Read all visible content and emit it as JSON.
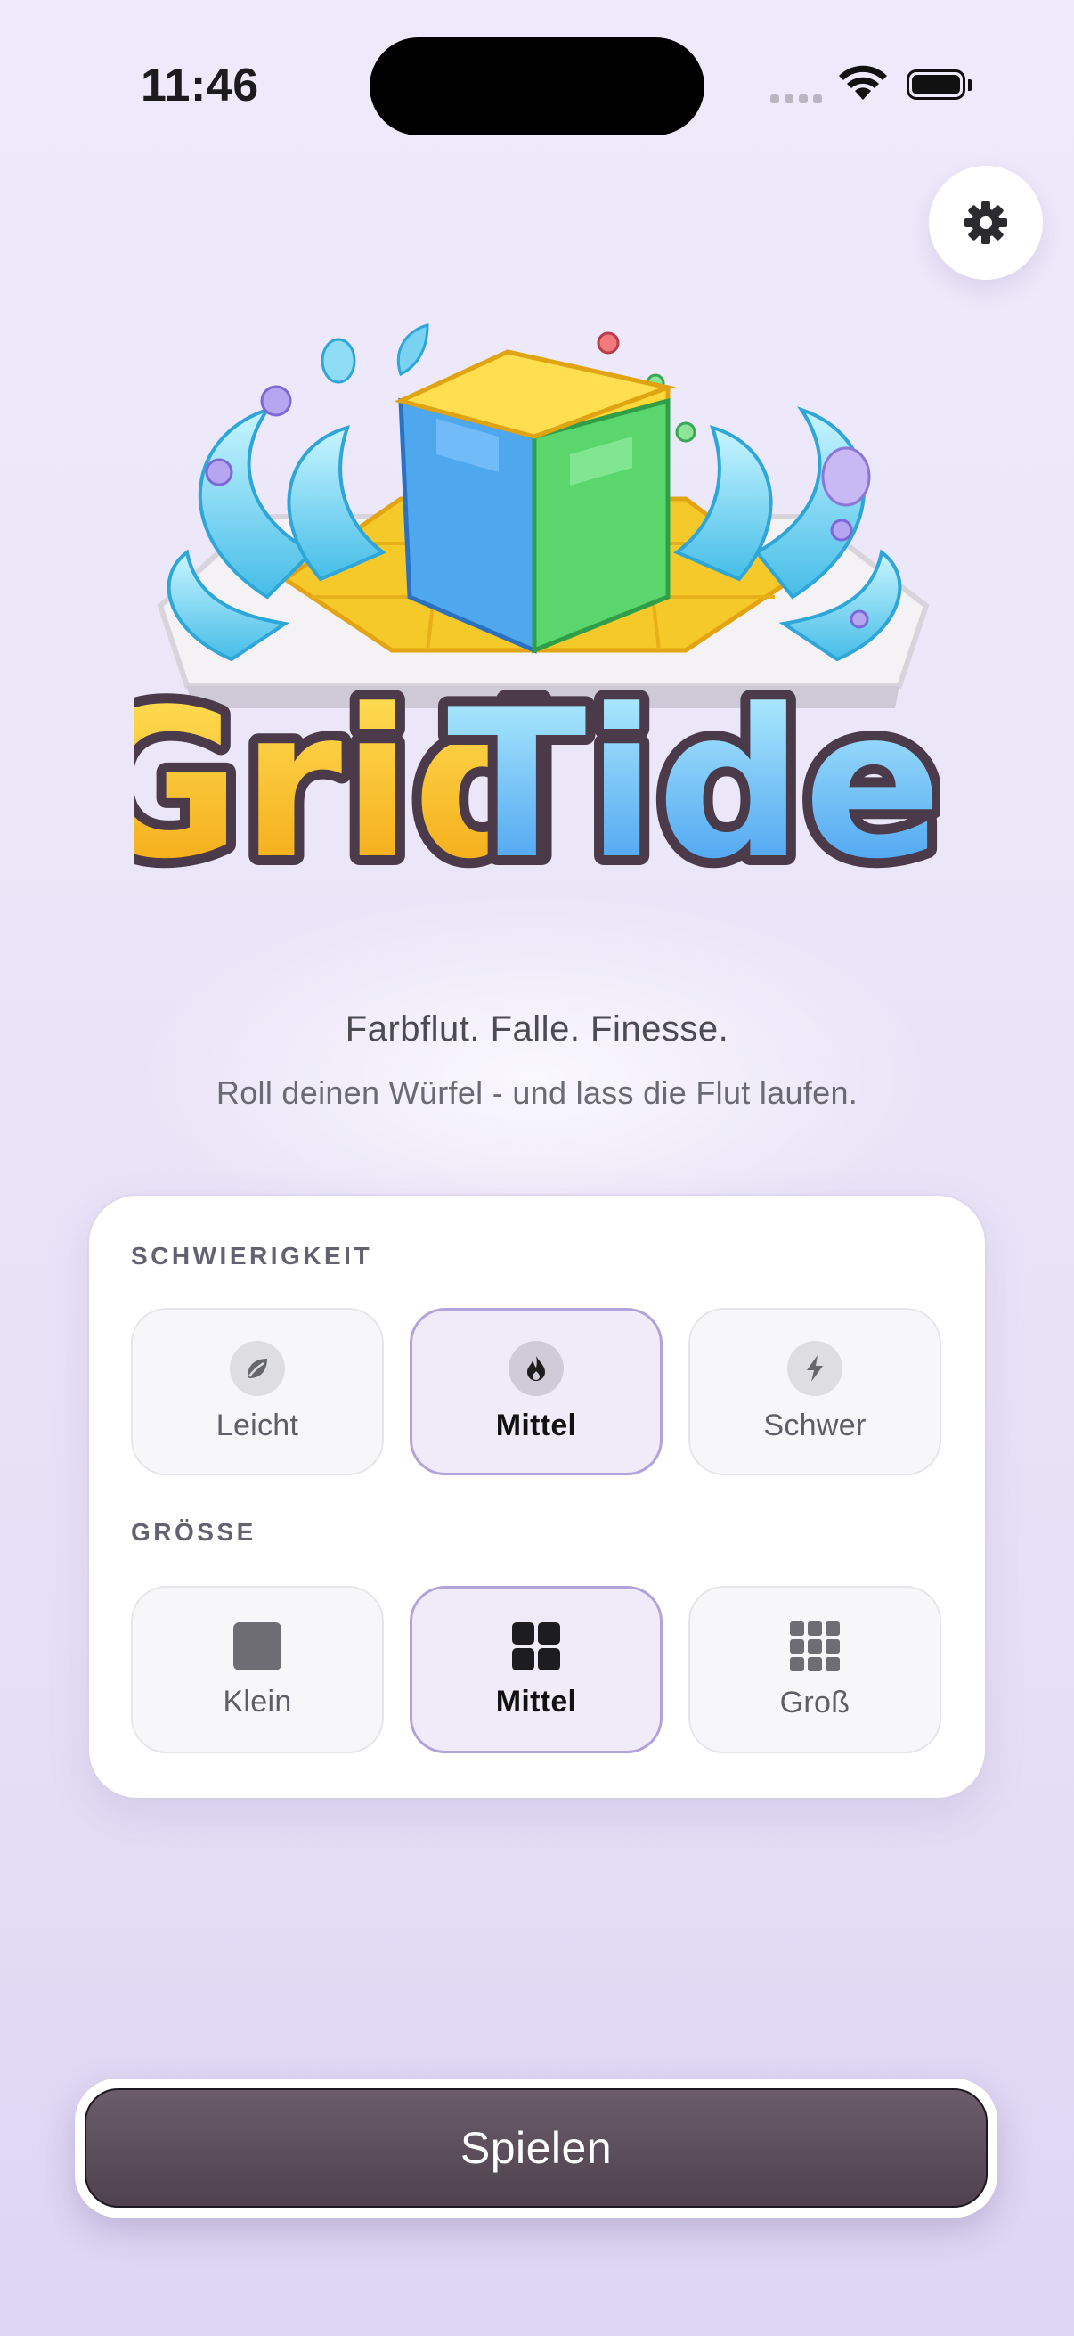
{
  "status_bar": {
    "time": "11:46"
  },
  "header": {
    "settings_icon": "gear-icon"
  },
  "logo": {
    "title_part1": "Grid",
    "title_part2": "Tide"
  },
  "intro": {
    "tagline": "Farbflut. Falle. Finesse.",
    "subtitle": "Roll deinen Würfel - und lass die Flut laufen."
  },
  "difficulty": {
    "label": "SCHWIERIGKEIT",
    "selected": "Mittel",
    "options": [
      {
        "label": "Leicht",
        "icon": "leaf-icon"
      },
      {
        "label": "Mittel",
        "icon": "flame-icon"
      },
      {
        "label": "Schwer",
        "icon": "bolt-icon"
      }
    ]
  },
  "size": {
    "label": "GRÖSSE",
    "selected": "Mittel",
    "options": [
      {
        "label": "Klein",
        "icon": "grid-1x1-icon"
      },
      {
        "label": "Mittel",
        "icon": "grid-2x2-icon"
      },
      {
        "label": "Groß",
        "icon": "grid-3x3-icon"
      }
    ]
  },
  "play_button": {
    "label": "Spielen"
  },
  "colors": {
    "accent_border": "#b1a3da",
    "selected_bg": "#efebf9",
    "play_button": "#5a4c58",
    "logo_yellow": "#f7c21c",
    "logo_blue": "#4aa9f2",
    "logo_green": "#5bd86a"
  }
}
